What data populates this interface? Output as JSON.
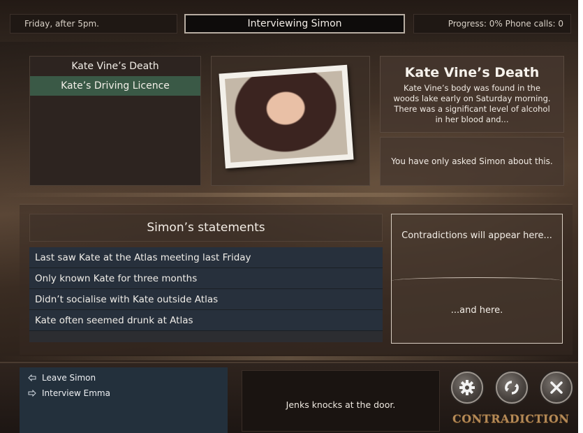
{
  "header": {
    "time_label": "Friday, after 5pm.",
    "title": "Interviewing Simon",
    "status": "Progress: 0%  Phone calls: 0"
  },
  "evidence": {
    "items": [
      {
        "label": "Kate Vine’s Death",
        "active": false
      },
      {
        "label": "Kate’s Driving Licence",
        "active": true
      }
    ]
  },
  "info": {
    "title": "Kate Vine’s Death",
    "description": "Kate Vine’s body was found in the woods lake early on Saturday morning. There was a significant level of alcohol in her blood and...",
    "note": "You have only asked Simon about this."
  },
  "statements": {
    "heading": "Simon’s statements",
    "items": [
      "Last saw Kate at the Atlas meeting last Friday",
      "Only known Kate for three months",
      "Didn’t socialise with Kate outside Atlas",
      "Kate often seemed drunk at Atlas"
    ]
  },
  "contradictions": {
    "top_text": "Contradictions will appear here...",
    "bottom_text": "...and here."
  },
  "navigation": {
    "items": [
      {
        "label": "Leave Simon",
        "icon": "arrow-left-icon"
      },
      {
        "label": "Interview Emma",
        "icon": "arrow-right-icon"
      }
    ]
  },
  "message": "Jenks knocks at the door.",
  "controls": {
    "icons": [
      "settings-gear-icon",
      "refresh-icon",
      "close-icon"
    ]
  },
  "logo": {
    "text": "CONTRADICTION",
    "colour": "#b58a56"
  }
}
